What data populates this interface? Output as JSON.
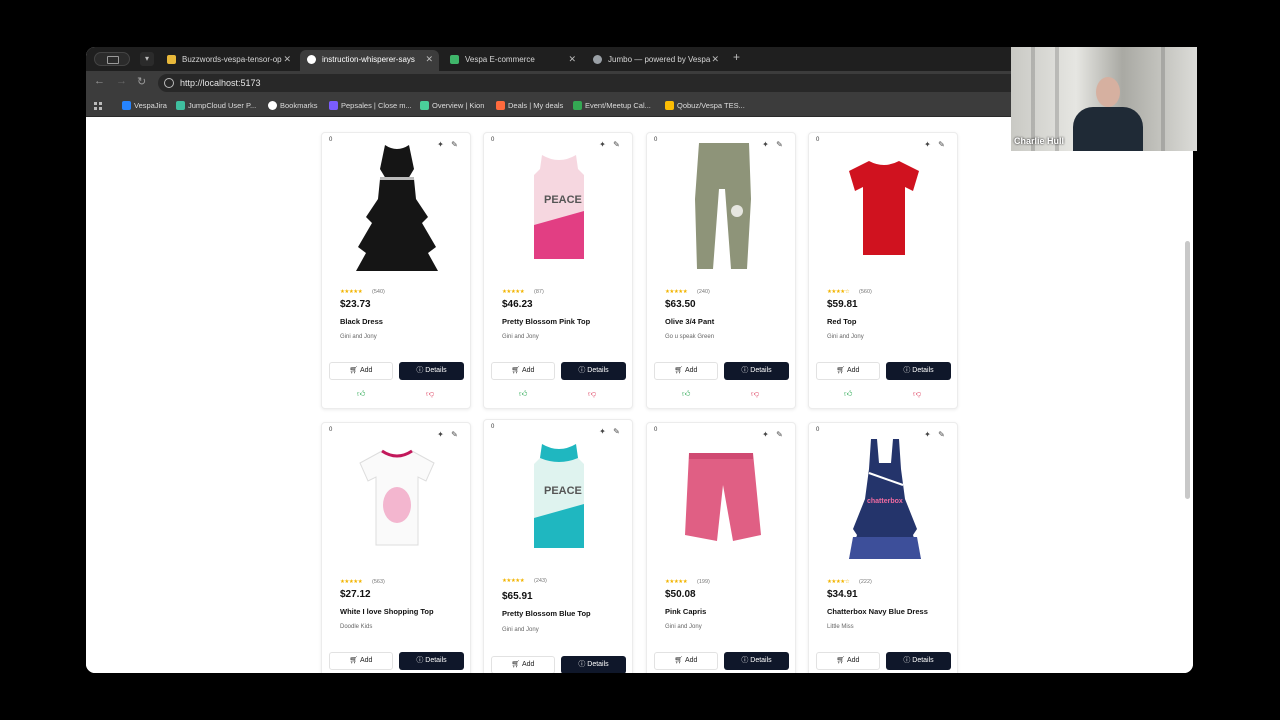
{
  "browser": {
    "tabs": [
      {
        "title": "Buzzwords-vespa-tensor-op",
        "active": false,
        "color": "#e8b83a"
      },
      {
        "title": "instruction-whisperer-says",
        "active": true,
        "color": "#ffffff"
      },
      {
        "title": "Vespa E-commerce",
        "active": false,
        "color": "#3fb56a"
      },
      {
        "title": "Jumbo — powered by Vespa",
        "active": false,
        "color": "#9aa0a6"
      }
    ],
    "url": "http://localhost:5173",
    "bookmarks": [
      {
        "label": "VespaJira",
        "color": "#2684ff"
      },
      {
        "label": "JumpCloud User P...",
        "color": "#3fbf9f"
      },
      {
        "label": "Bookmarks",
        "color": "#ffffff"
      },
      {
        "label": "Pepsales | Close m...",
        "color": "#7a5cff"
      },
      {
        "label": "Overview | Kion",
        "color": "#4ad09a"
      },
      {
        "label": "Deals | My deals",
        "color": "#ff6a3d"
      },
      {
        "label": "Event/Meetup Cal...",
        "color": "#34a853"
      },
      {
        "label": "Qobuz/Vespa TES...",
        "color": "#fbbc04"
      }
    ]
  },
  "products": [
    {
      "count": "0",
      "stars": "★★★★★",
      "reviews": "(540)",
      "price": "$23.73",
      "title": "Black Dress",
      "brand": "Gini and Jony",
      "add": "Add",
      "details": "Details",
      "image": "black-dress"
    },
    {
      "count": "0",
      "stars": "★★★★★",
      "reviews": "(87)",
      "price": "$46.23",
      "title": "Pretty Blossom Pink Top",
      "brand": "Gini and Jony",
      "add": "Add",
      "details": "Details",
      "image": "pink-top"
    },
    {
      "count": "0",
      "stars": "★★★★★",
      "reviews": "(240)",
      "price": "$63.50",
      "title": "Olive 3/4 Pant",
      "brand": "Go u speak Green",
      "add": "Add",
      "details": "Details",
      "image": "olive-pant"
    },
    {
      "count": "0",
      "stars": "★★★★☆",
      "reviews": "(560)",
      "price": "$59.81",
      "title": "Red Top",
      "brand": "Gini and Jony",
      "add": "Add",
      "details": "Details",
      "image": "red-top"
    },
    {
      "count": "0",
      "stars": "★★★★★",
      "reviews": "(563)",
      "price": "$27.12",
      "title": "White I love Shopping Top",
      "brand": "Doodle Kids",
      "add": "Add",
      "details": "Details",
      "image": "white-top"
    },
    {
      "count": "0",
      "stars": "★★★★★",
      "reviews": "(243)",
      "price": "$65.91",
      "title": "Pretty Blossom Blue Top",
      "brand": "Gini and Jony",
      "add": "Add",
      "details": "Details",
      "image": "blue-top"
    },
    {
      "count": "0",
      "stars": "★★★★★",
      "reviews": "(199)",
      "price": "$50.08",
      "title": "Pink Capris",
      "brand": "Gini and Jony",
      "add": "Add",
      "details": "Details",
      "image": "pink-capris"
    },
    {
      "count": "0",
      "stars": "★★★★☆",
      "reviews": "(222)",
      "price": "$34.91",
      "title": "Chatterbox Navy Blue Dress",
      "brand": "Little Miss",
      "add": "Add",
      "details": "Details",
      "image": "navy-dress"
    }
  ],
  "video": {
    "name": "Charlie Hull"
  }
}
